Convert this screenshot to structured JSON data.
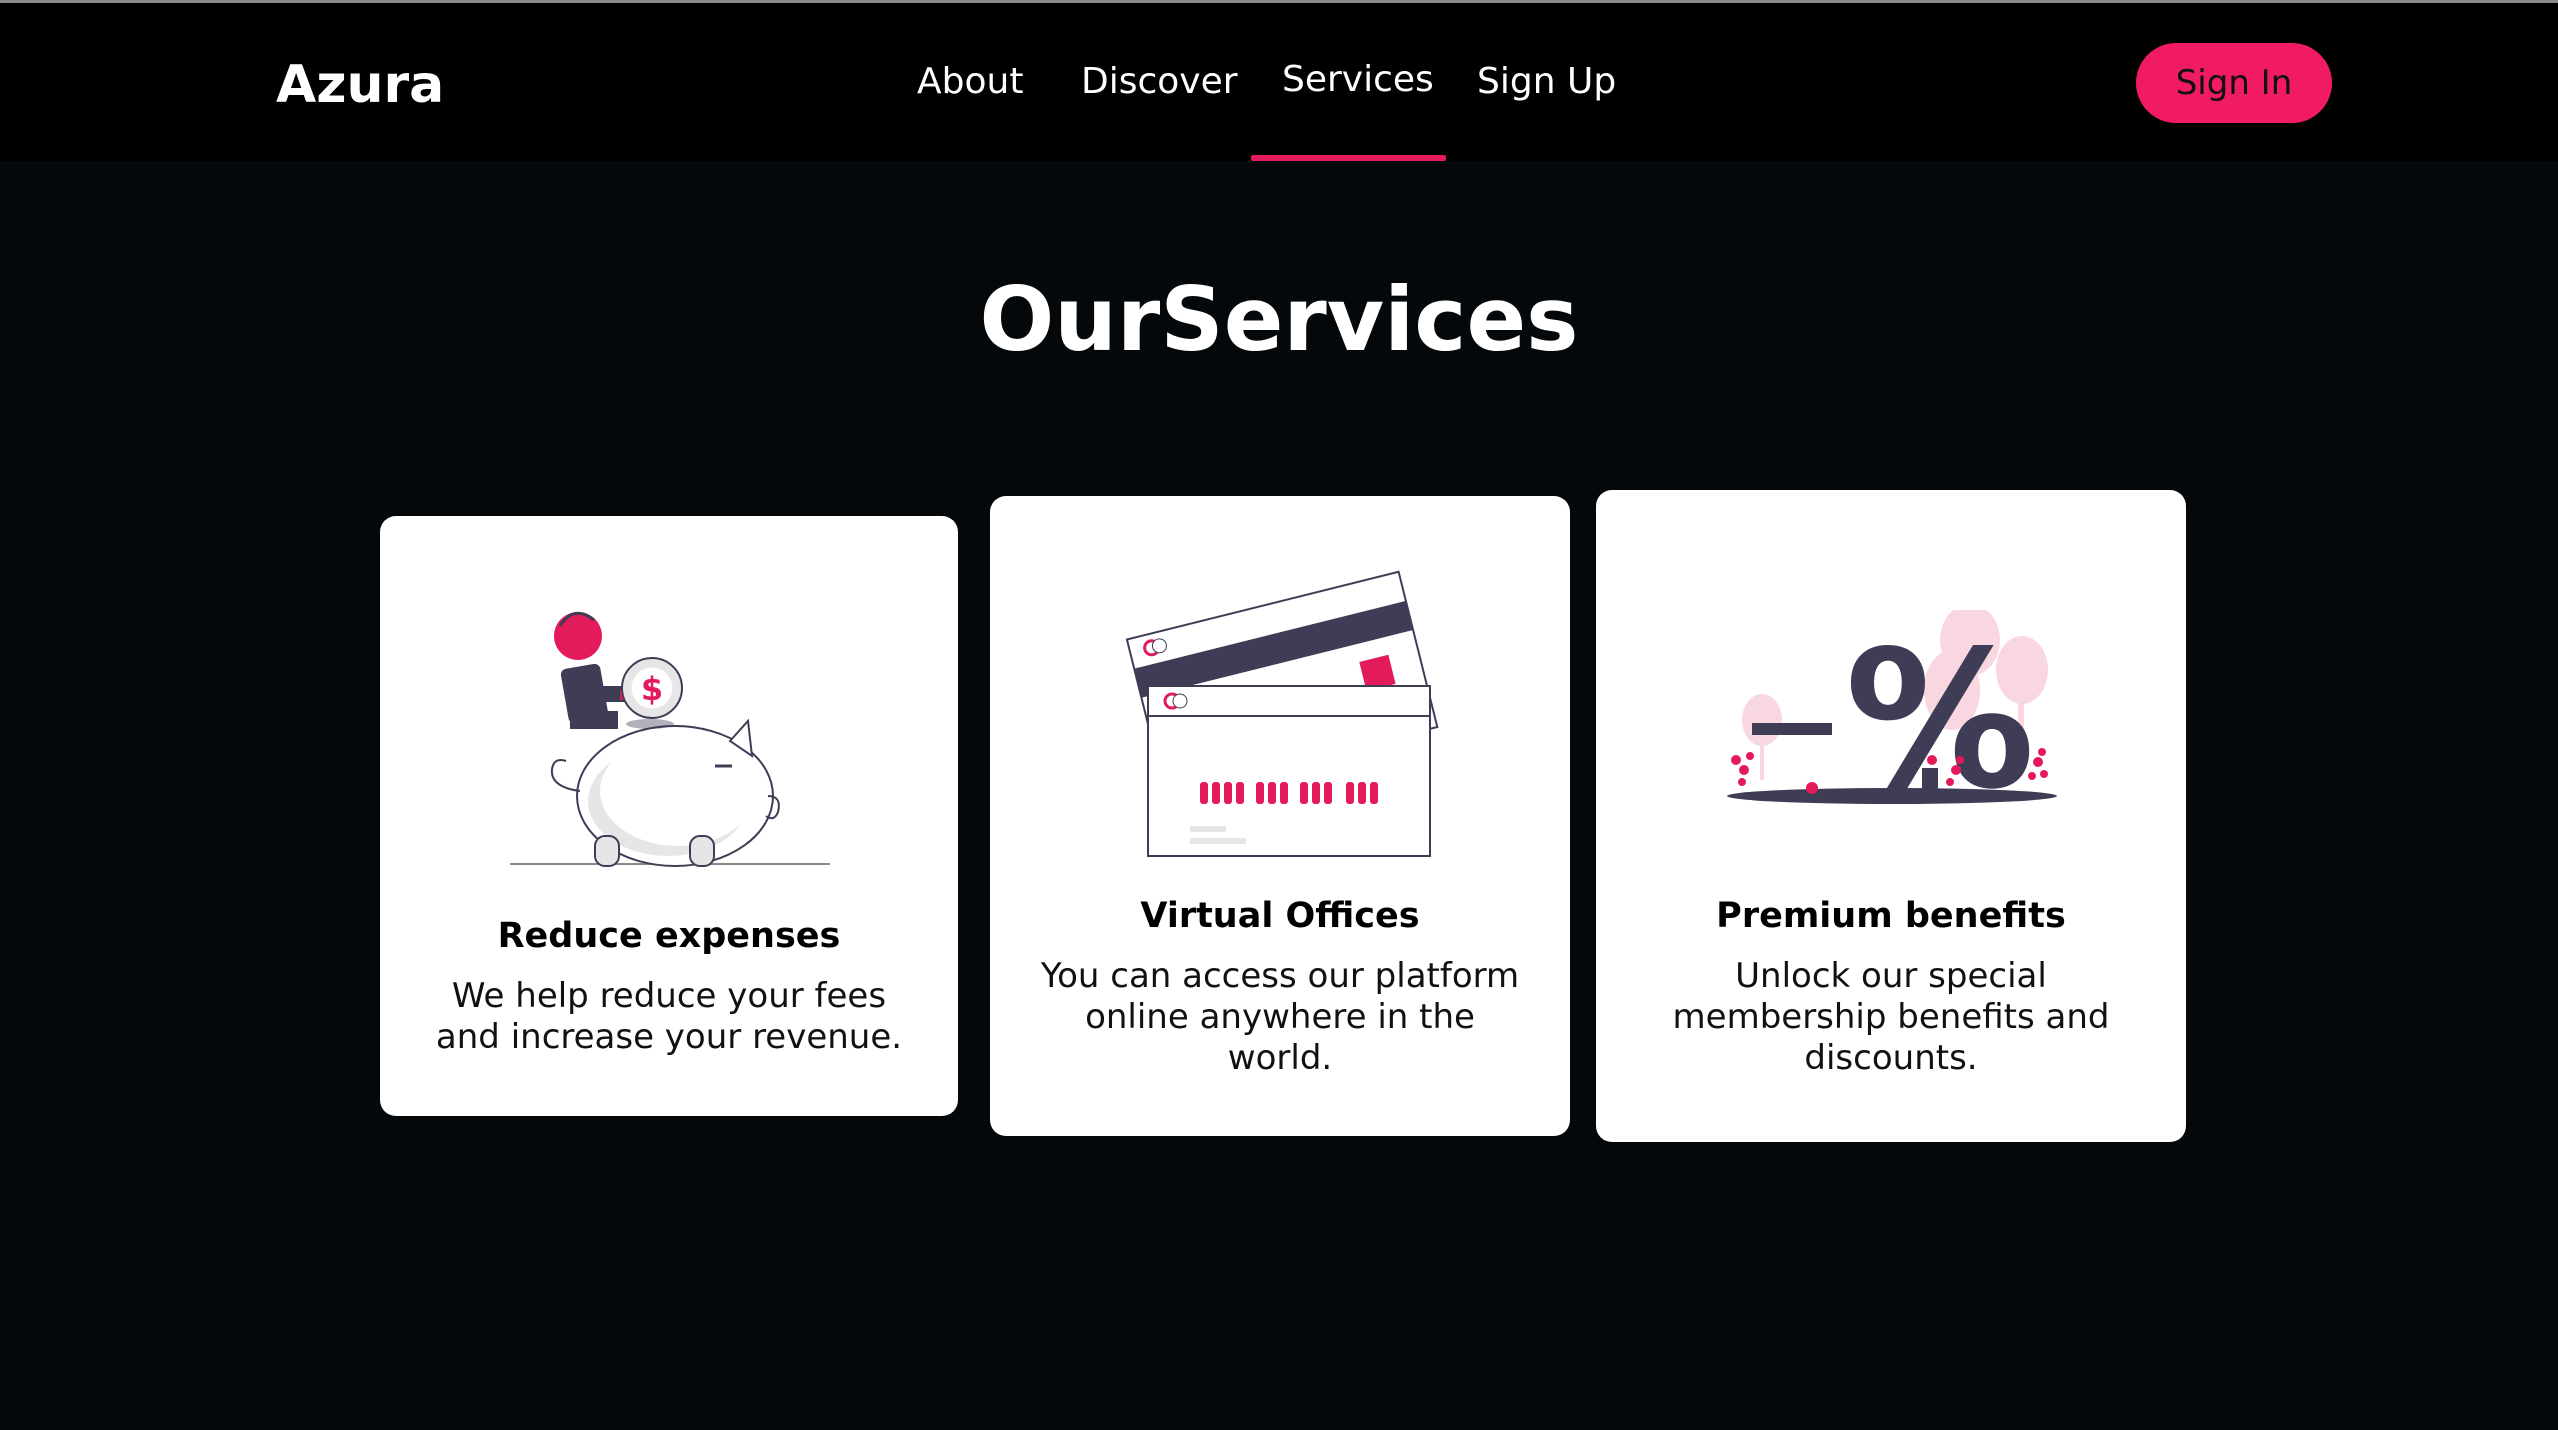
{
  "brand": {
    "name": "Azura",
    "accent": "#f01b62"
  },
  "nav": {
    "links": [
      "About",
      "Discover",
      "Services",
      "Sign Up"
    ],
    "active": "Services",
    "signin_label": "Sign In"
  },
  "services": {
    "title": "OurServices",
    "cards": [
      {
        "title": "Reduce expenses",
        "text": "We help reduce your fees and increase your revenue.",
        "illustration": "piggy-bank-illustration"
      },
      {
        "title": "Virtual Offices",
        "text": "You can access our platform online anywhere in the world.",
        "illustration": "credit-cards-illustration"
      },
      {
        "title": "Premium benefits",
        "text": "Unlock our special membership benefits and discounts.",
        "illustration": "percent-discount-illustration"
      }
    ]
  }
}
